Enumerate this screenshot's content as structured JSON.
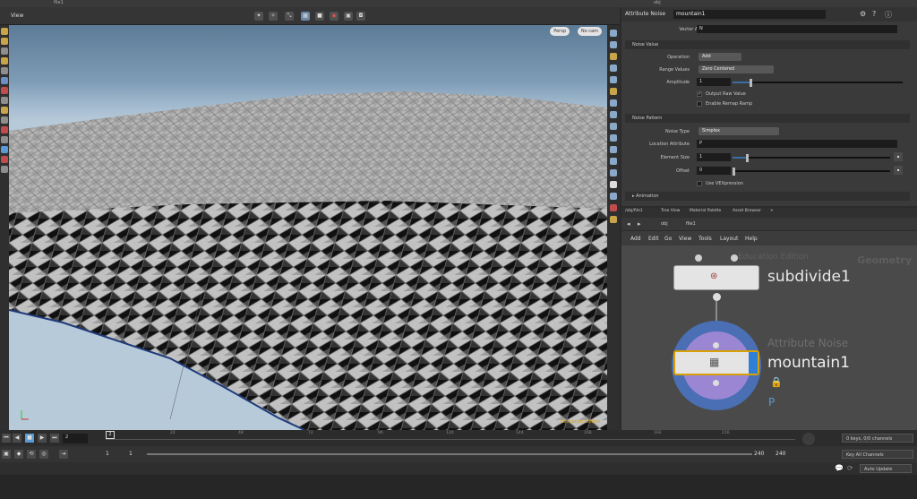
{
  "window": {
    "obj_label": "obj",
    "file_label": "file1"
  },
  "viewport": {
    "tab_label": "View",
    "persp_label": "Persp",
    "cam_label": "No cam",
    "watermark": "Education Edition"
  },
  "params": {
    "node_type": "Attribute Noise",
    "node_name": "mountain1",
    "vector_attribute_label": "Vector Attribute",
    "vector_attribute_value": "N",
    "section_noise_value": "Noise Value",
    "operation_label": "Operation",
    "operation_value": "Add",
    "range_values_label": "Range Values",
    "range_values_value": "Zero Centered",
    "amplitude_label": "Amplitude",
    "amplitude_value": "1",
    "output_raw_label": "Output Raw Value",
    "output_raw_checked": true,
    "remap_label": "Enable Remap Ramp",
    "section_noise_pattern": "Noise Pattern",
    "noise_type_label": "Noise Type",
    "noise_type_value": "Simplex",
    "location_attr_label": "Location Attribute",
    "location_attr_value": "P",
    "element_size_label": "Element Size",
    "element_size_value": "1",
    "offset_label": "Offset",
    "offset_value": "0",
    "vexpression_label": "Use VEXpression",
    "section_animation": "Animation"
  },
  "network": {
    "tabs": [
      "/obj/file1",
      "Tree View",
      "Material Palette",
      "Asset Browser"
    ],
    "path_obj": "obj",
    "path_file": "file1",
    "menu": [
      "Add",
      "Edit",
      "Go",
      "View",
      "Tools",
      "Layout",
      "Help"
    ],
    "context_label": "Geometry",
    "edition_label": "Education Edition",
    "node1_name": "subdivide1",
    "node2_type": "Attribute Noise",
    "node2_name": "mountain1",
    "node2_flag": "P"
  },
  "timeline": {
    "current_frame": "2",
    "frame_marker": "2",
    "ticks": [
      "24",
      "48",
      "72",
      "96",
      "120",
      "144",
      "168",
      "192",
      "216"
    ],
    "start_frame": "1",
    "range_start": "1",
    "range_end": "240",
    "end_frame": "240",
    "keys_label": "0 keys, 0/0 channels",
    "key_all_label": "Key All Channels",
    "auto_update_label": "Auto Update"
  },
  "colors": {
    "sky_top": "#5c7b96",
    "terrain": "#a9a9a9",
    "node_selected": "#9b86d4",
    "node_ring": "#4a6fb5"
  }
}
